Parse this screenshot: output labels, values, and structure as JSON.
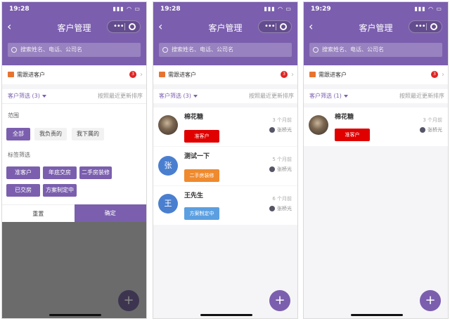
{
  "common": {
    "title": "客户管理",
    "back_icon": "chevron-left-icon",
    "more_glyph": "•••",
    "search_placeholder": "搜索姓名、电话、公司名",
    "follow_label": "需跟进客户",
    "follow_count": "3",
    "sort_label": "按照最近更新排序",
    "fab_label": "+",
    "colors": {
      "primary": "#7b5fae",
      "tag_red": "#e00000",
      "tag_orange": "#ef8a2e",
      "tag_blue": "#5b9fe0",
      "avatar_blue": "#4a7fd0"
    }
  },
  "screens": [
    {
      "time": "19:28",
      "filter_label": "客户筛选 (3)",
      "filter_panel": {
        "scope_title": "范围",
        "scope_options": [
          "全部",
          "我负责的",
          "我下属的"
        ],
        "scope_selected": "全部",
        "tag_title": "标签筛选",
        "tags": [
          "准客户",
          "年底交房",
          "二手房装修",
          "已交房",
          "方案制定中"
        ],
        "reset_label": "重置",
        "confirm_label": "确定"
      }
    },
    {
      "time": "19:28",
      "filter_label": "客户筛选 (3)",
      "customers": [
        {
          "name": "棉花糖",
          "avatar": "photo",
          "tag": "准客户",
          "tag_color": "red",
          "updated": "3 个月前",
          "owner": "张桥光"
        },
        {
          "name": "测试一下",
          "avatar": "张",
          "tag": "二手房装修",
          "tag_color": "orange",
          "updated": "5 个月前",
          "owner": "张桥光"
        },
        {
          "name": "王先生",
          "avatar": "王",
          "tag": "方案制定中",
          "tag_color": "blue",
          "updated": "6 个月前",
          "owner": "张桥光"
        }
      ]
    },
    {
      "time": "19:29",
      "filter_label": "客户筛选 (1)",
      "customers": [
        {
          "name": "棉花糖",
          "avatar": "photo",
          "tag": "准客户",
          "tag_color": "red",
          "updated": "3 个月前",
          "owner": "张桥光"
        }
      ]
    }
  ]
}
